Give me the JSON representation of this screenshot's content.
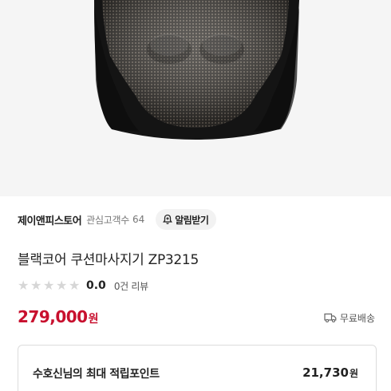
{
  "product_image": {
    "description_icon": "massage-cushion-image"
  },
  "store": {
    "name": "제이앤피스토어",
    "follower_label": "관심고객수",
    "follower_count": "64",
    "alert_button_label": "알림받기"
  },
  "product": {
    "title": "블랙코어 쿠션마사지기 ZP3215",
    "rating": "0.0",
    "rating_stars": 0,
    "review_count_label": "0건 리뷰",
    "price": "279,000",
    "currency": "원",
    "shipping_label": "무료배송"
  },
  "points": {
    "label": "수호신님의 최대 적립포인트",
    "value": "21,730",
    "unit": "원"
  },
  "colors": {
    "price": "#c8102e",
    "star_empty": "#d6d6d6",
    "alert_button_bg": "#f2f2f2"
  }
}
